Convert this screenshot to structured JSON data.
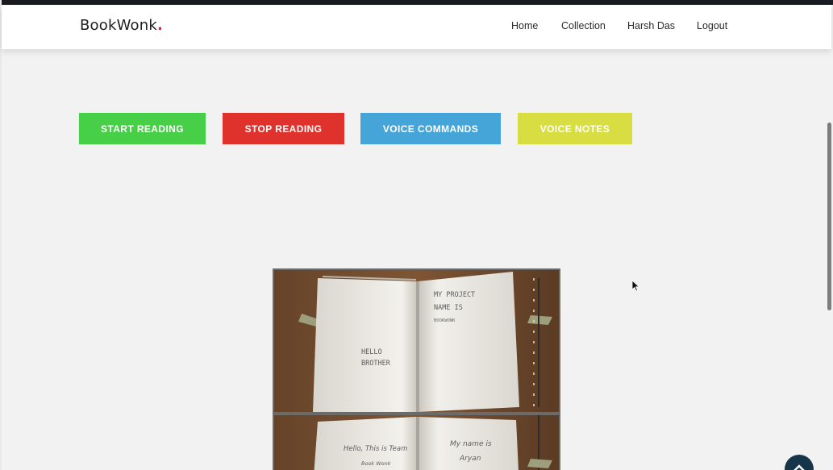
{
  "brand": {
    "name": "BookWonk",
    "dot": ".",
    "accent_color": "#e0262a"
  },
  "nav": {
    "items": [
      {
        "label": "Home"
      },
      {
        "label": "Collection"
      },
      {
        "label": "Harsh Das"
      },
      {
        "label": "Logout"
      }
    ]
  },
  "controls": {
    "start_reading": {
      "label": "START READING",
      "color": "#46cf47"
    },
    "stop_reading": {
      "label": "STOP READING",
      "color": "#e0322d"
    },
    "voice_commands": {
      "label": "VOICE COMMANDS",
      "color": "#46a5d8"
    },
    "voice_notes": {
      "label": "VOICE NOTES",
      "color": "#d8dd41"
    }
  },
  "camera_feed": {
    "frame1": {
      "left_page": [
        "HELLO",
        "BROTHER"
      ],
      "right_page": [
        "MY PROJECT",
        "NAME IS",
        "BOOKWONK"
      ]
    },
    "frame2": {
      "left_page": [
        "Hello, This is Team",
        "Book Wonk"
      ],
      "right_page": [
        "My name is",
        "Aryan"
      ]
    }
  },
  "icons": {
    "back_to_top": "chevron-up-icon",
    "cursor": "mouse-pointer-icon"
  }
}
